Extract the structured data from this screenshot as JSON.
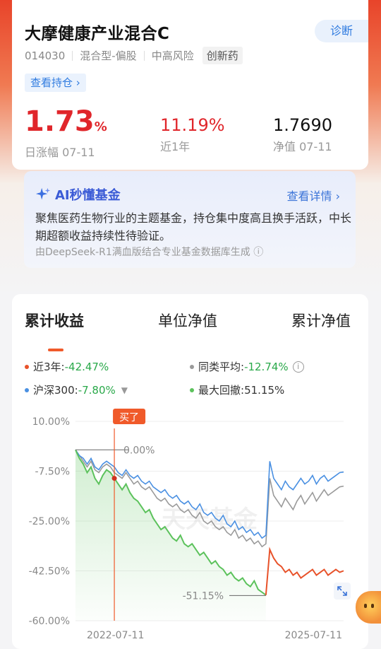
{
  "fund": {
    "name": "大摩健康产业混合C",
    "diagnose_label": "诊断",
    "code": "014030",
    "type": "混合型-偏股",
    "risk": "中高风险",
    "tag": "创新药",
    "holdings_label": "查看持仓 ›"
  },
  "stats": {
    "day_change": "1.73",
    "day_unit": "%",
    "day_label": "日涨幅 07-11",
    "year_change": "11.19%",
    "year_label": "近1年",
    "nav": "1.7690",
    "nav_label": "净值 07-11"
  },
  "ai": {
    "title": "AI秒懂基金",
    "more": "查看详情 ›",
    "body": "聚焦医药生物行业的主题基金，持仓集中度高且换手活跃，中长期超额收益持续性待验证。",
    "source": "由DeepSeek-R1满血版结合专业基金数据库生成 ⓘ"
  },
  "tabs": [
    "累计收益",
    "单位净值",
    "累计净值"
  ],
  "legend": {
    "fund_label": "近3年:",
    "fund_value": "-42.47%",
    "peer_label": "同类平均:",
    "peer_value": "-12.74%",
    "index_label": "沪深300:",
    "index_value": "-7.80%",
    "dd_label": "最大回撤:",
    "dd_value": "51.15%"
  },
  "colors": {
    "fund": "#e8522a",
    "peer": "#9a9a9a",
    "index": "#4a90e2",
    "drawdown": "#5cc25c",
    "up": "#e0262b",
    "link": "#2f7be0"
  },
  "chart_data": {
    "type": "line",
    "y_ticks": [
      "10.00%",
      "-7.50%",
      "-25.00%",
      "-42.50%",
      "-60.00%"
    ],
    "ylim": [
      -60,
      10
    ],
    "x_start_label": "2022-07-11",
    "x_end_label": "2025-07-11",
    "buy_label": "买了",
    "peak_label": "0.00%",
    "trough_label": "-51.15%",
    "watermark": "天天基金",
    "series": [
      {
        "name": "近3年",
        "values": [
          0,
          -3,
          -5,
          -8,
          -6,
          -10,
          -12,
          -9,
          -7,
          -8,
          -10,
          -12,
          -14,
          -12,
          -15,
          -17,
          -18,
          -20,
          -22,
          -21,
          -24,
          -26,
          -28,
          -27,
          -29,
          -31,
          -32,
          -30,
          -33,
          -34,
          -33,
          -35,
          -37,
          -36,
          -38,
          -40,
          -39,
          -41,
          -42,
          -44,
          -43,
          -45,
          -46,
          -45,
          -47,
          -48,
          -46,
          -49,
          -50,
          -51,
          -35,
          -38,
          -40,
          -41,
          -43,
          -42,
          -44,
          -43,
          -45,
          -44,
          -43,
          -42,
          -44,
          -43,
          -42,
          -44,
          -43,
          -42,
          -43,
          -42.47
        ]
      },
      {
        "name": "同类平均",
        "values": [
          0,
          -2,
          -4,
          -6,
          -4,
          -7,
          -8,
          -6,
          -5,
          -6,
          -8,
          -9,
          -10,
          -8,
          -10,
          -12,
          -11,
          -13,
          -14,
          -13,
          -15,
          -17,
          -18,
          -17,
          -19,
          -20,
          -19,
          -21,
          -22,
          -21,
          -23,
          -24,
          -22,
          -25,
          -26,
          -25,
          -27,
          -28,
          -27,
          -29,
          -30,
          -28,
          -31,
          -30,
          -32,
          -31,
          -33,
          -32,
          -34,
          -33,
          -10,
          -16,
          -18,
          -20,
          -17,
          -19,
          -21,
          -18,
          -16,
          -19,
          -17,
          -15,
          -18,
          -16,
          -14,
          -16,
          -15,
          -14,
          -13,
          -12.74
        ]
      },
      {
        "name": "沪深300",
        "values": [
          0,
          -2,
          -3,
          -5,
          -3,
          -6,
          -7,
          -5,
          -4,
          -5,
          -6,
          -8,
          -9,
          -7,
          -9,
          -10,
          -9,
          -11,
          -12,
          -11,
          -13,
          -14,
          -15,
          -14,
          -16,
          -17,
          -16,
          -18,
          -19,
          -18,
          -20,
          -21,
          -19,
          -22,
          -23,
          -22,
          -24,
          -25,
          -23,
          -26,
          -27,
          -25,
          -28,
          -27,
          -29,
          -28,
          -30,
          -29,
          -31,
          -30,
          -4,
          -10,
          -12,
          -14,
          -11,
          -13,
          -14,
          -12,
          -10,
          -12,
          -11,
          -9,
          -12,
          -10,
          -9,
          -11,
          -10,
          -9,
          -8,
          -7.8
        ]
      }
    ],
    "max_drawdown": 51.15
  }
}
